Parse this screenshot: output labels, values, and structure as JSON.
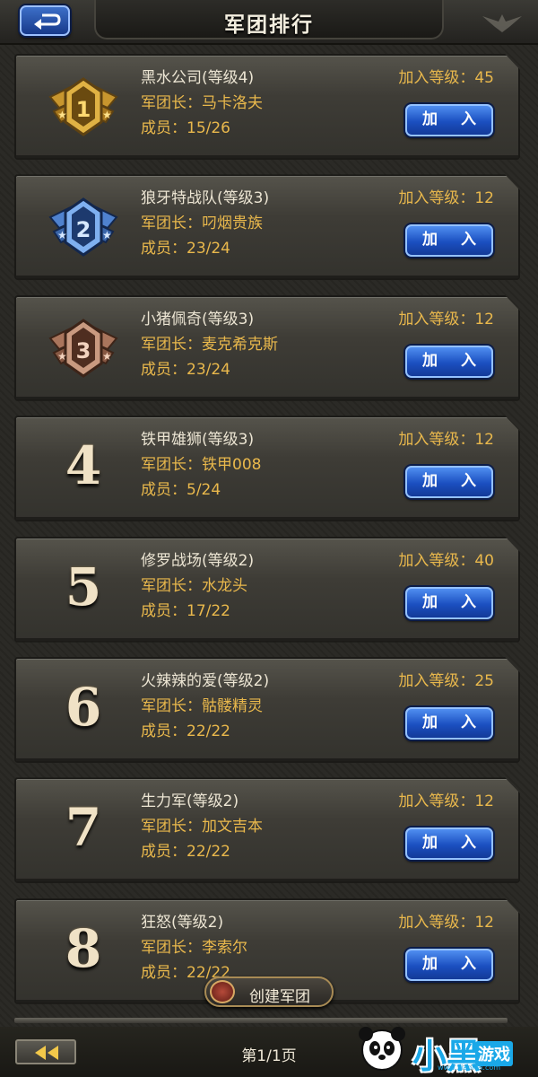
{
  "header": {
    "title": "军团排行"
  },
  "guilds": [
    {
      "rank": "1",
      "name": "黑水公司(等级4)",
      "leader": "军团长：马卡洛夫",
      "members": "成员：15/26",
      "join_level": "加入等级：45",
      "join_label": "加 入",
      "badge": "gold"
    },
    {
      "rank": "2",
      "name": "狼牙特战队(等级3)",
      "leader": "军团长：叼烟贵族",
      "members": "成员：23/24",
      "join_level": "加入等级：12",
      "join_label": "加 入",
      "badge": "blue"
    },
    {
      "rank": "3",
      "name": "小猪佩奇(等级3)",
      "leader": "军团长：麦克希克斯",
      "members": "成员：23/24",
      "join_level": "加入等级：12",
      "join_label": "加 入",
      "badge": "bronze"
    },
    {
      "rank": "4",
      "name": "铁甲雄狮(等级3)",
      "leader": "军团长：铁甲008",
      "members": "成员：5/24",
      "join_level": "加入等级：12",
      "join_label": "加 入"
    },
    {
      "rank": "5",
      "name": "修罗战场(等级2)",
      "leader": "军团长：水龙头",
      "members": "成员：17/22",
      "join_level": "加入等级：40",
      "join_label": "加 入"
    },
    {
      "rank": "6",
      "name": "火辣辣的爱(等级2)",
      "leader": "军团长：骷髅精灵",
      "members": "成员：22/22",
      "join_level": "加入等级：25",
      "join_label": "加 入"
    },
    {
      "rank": "7",
      "name": "生力军(等级2)",
      "leader": "军团长：加文吉本",
      "members": "成员：22/22",
      "join_level": "加入等级：12",
      "join_label": "加 入"
    },
    {
      "rank": "8",
      "name": "狂怒(等级2)",
      "leader": "军团长：李索尔",
      "members": "成员：22/22",
      "join_level": "加入等级：12",
      "join_label": "加 入"
    }
  ],
  "create_button": {
    "label": "创建军团"
  },
  "footer": {
    "page_label": "第1/1页"
  },
  "watermark": {
    "brand": "小黑",
    "suffix": "游戏",
    "url": "www.xiaohei.com"
  },
  "colors": {
    "accent_blue": "#1b4fc0",
    "gold_text": "#e9b84c",
    "badge_gold": "#d9a83a",
    "badge_blue": "#3f78c9",
    "badge_bronze": "#9a6a52"
  }
}
